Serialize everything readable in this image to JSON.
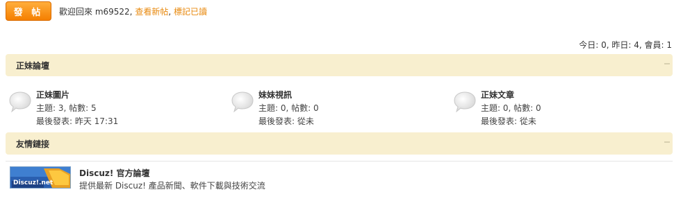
{
  "toolbar": {
    "post_label": "發 帖",
    "welcome_prefix": "歡迎回來 m69522,",
    "new_posts_link": "查看新帖",
    "comma": ",",
    "mark_read_link": "標記已讀"
  },
  "stats": {
    "text": "今日: 0, 昨日: 4, 會員: 1"
  },
  "forum_section": {
    "title": "正妹論壇",
    "forums": [
      {
        "name": "正妹圖片",
        "stats": "主題: 3, 帖數: 5",
        "last_post": "最後發表: 昨天 17:31"
      },
      {
        "name": "妹妹視訊",
        "stats": "主題: 0, 帖數: 0",
        "last_post": "最後發表: 從未"
      },
      {
        "name": "正妹文章",
        "stats": "主題: 0, 帖數: 0",
        "last_post": "最後發表: 從未"
      }
    ]
  },
  "links_section": {
    "title": "友情鏈接",
    "links": [
      {
        "logo_text": "Discuz!.net",
        "name": "Discuz! 官方論壇",
        "description": "提供最新 Discuz! 產品新聞、軟件下載與技術交流"
      }
    ]
  },
  "icons": {
    "forum_icon": "speech-bubble-icon",
    "collapse_icon": "minus-icon"
  },
  "colors": {
    "accent": "#f57f00",
    "link": "#e8890e",
    "header_bg": "#f8efcf"
  }
}
